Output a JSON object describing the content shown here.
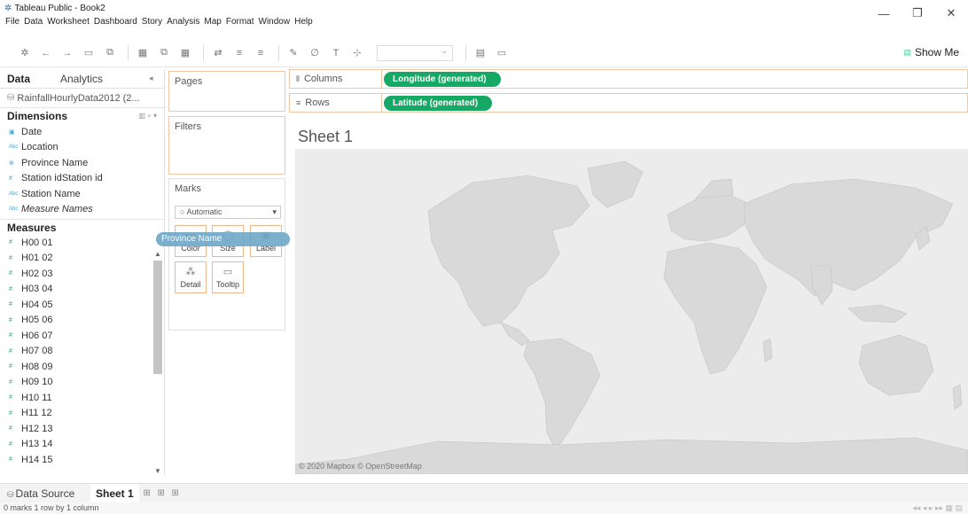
{
  "window": {
    "title": "Tableau Public - Book2",
    "controls": [
      "—",
      "❐",
      "✕"
    ]
  },
  "menu": [
    "File",
    "Data",
    "Worksheet",
    "Dashboard",
    "Story",
    "Analysis",
    "Map",
    "Format",
    "Window",
    "Help"
  ],
  "toolbar": {
    "show_me_label": "Show Me"
  },
  "data_pane": {
    "tab_data": "Data",
    "tab_analytics": "Analytics",
    "datasource": "RainfallHourlyData2012 (2...",
    "dimensions_label": "Dimensions",
    "dimensions": [
      {
        "label": "Date",
        "icon": "calendar-icon"
      },
      {
        "label": "Location",
        "icon": "abc-icon"
      },
      {
        "label": "Province Name",
        "icon": "globe-icon"
      },
      {
        "label": "Station idStation id",
        "icon": "hash-icon"
      },
      {
        "label": "Station Name",
        "icon": "abc-icon"
      },
      {
        "label": "Measure Names",
        "icon": "abc-icon"
      }
    ],
    "measures_label": "Measures",
    "measures": [
      "H00 01",
      "H01 02",
      "H02 03",
      "H03 04",
      "H04 05",
      "H05 06",
      "H06 07",
      "H07 08",
      "H08 09",
      "H09 10",
      "H10 11",
      "H11 12",
      "H12 13",
      "H13 14",
      "H14 15"
    ]
  },
  "shelves": {
    "pages": "Pages",
    "filters": "Filters",
    "marks": "Marks",
    "marks_type": "Automatic",
    "marks_buttons": {
      "color": "Color",
      "size": "Size",
      "label": "Label",
      "detail": "Detail",
      "tooltip": "Tooltip"
    },
    "columns_label": "Columns",
    "rows_label": "Rows",
    "columns_pill": "Longitude (generated)",
    "rows_pill": "Latitude (generated)"
  },
  "drag": {
    "field": "Province Name"
  },
  "sheet": {
    "title": "Sheet 1",
    "copyright": "© 2020 Mapbox © OpenStreetMap"
  },
  "tabs": {
    "data_source": "Data Source",
    "sheet1": "Sheet 1"
  },
  "status": {
    "text": "0 marks    1 row by 1 column"
  },
  "colors": {
    "pill_green": "#16a865",
    "drag_pill": "#6ea7c7",
    "shelf_border": "#f0c8a8",
    "map_land": "#d9d9d9",
    "map_water": "#ececec"
  }
}
